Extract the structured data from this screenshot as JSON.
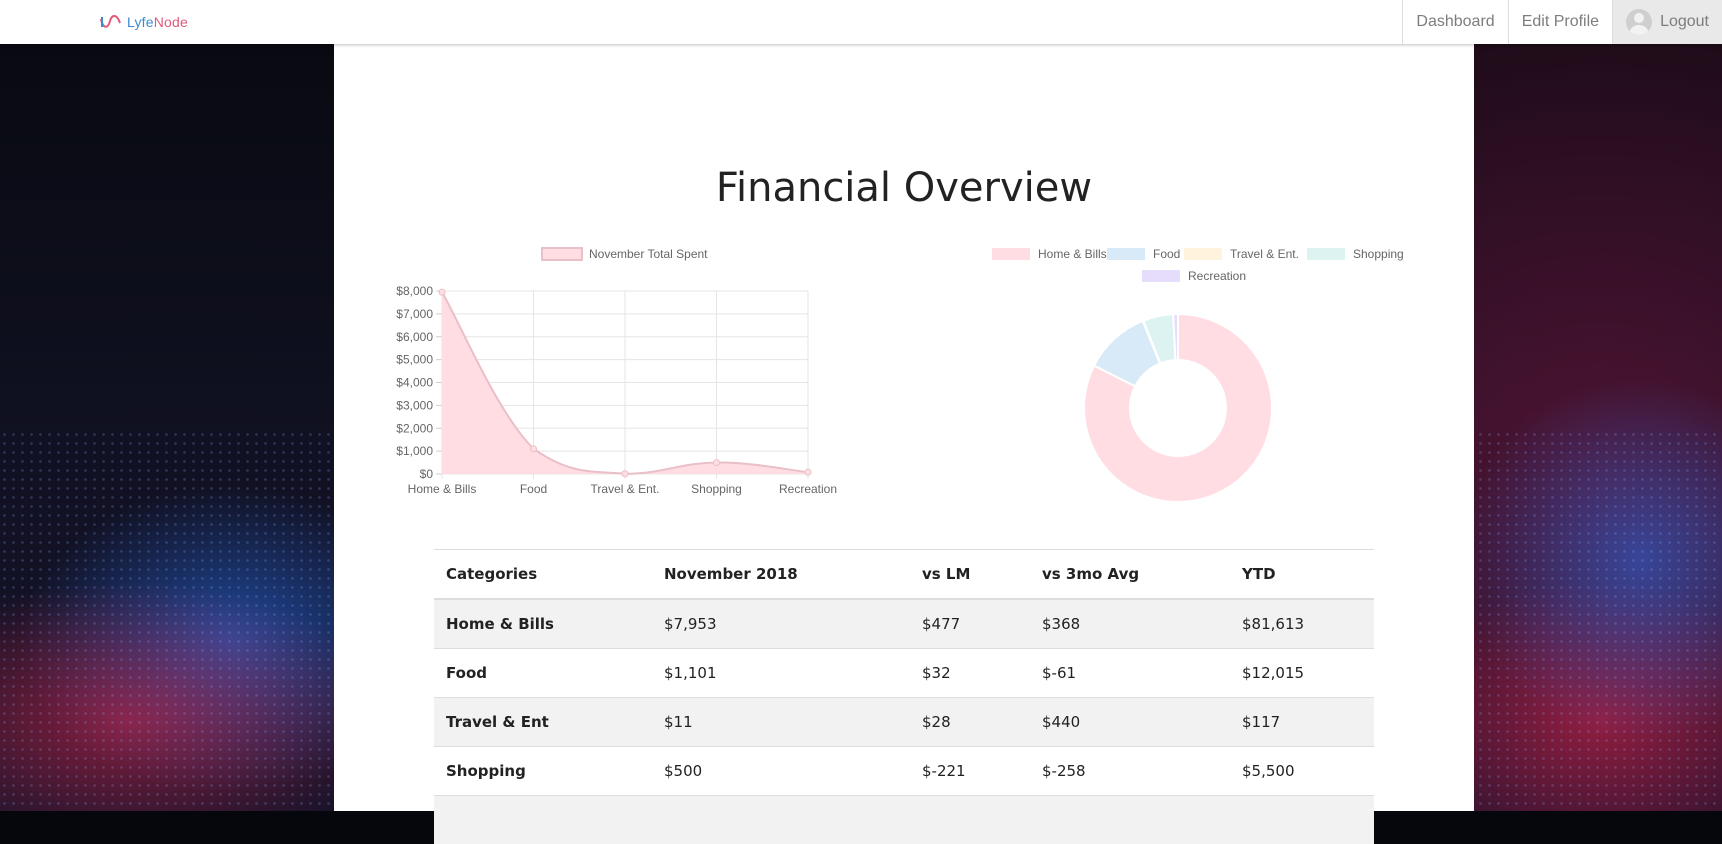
{
  "brand": {
    "part1": "Lyfe",
    "part2": "Node"
  },
  "nav": {
    "dashboard": "Dashboard",
    "edit_profile": "Edit Profile",
    "logout": "Logout"
  },
  "page": {
    "title": "Financial Overview"
  },
  "colors": {
    "pink": "#ffdde3",
    "pink_border": "#e9bfc8",
    "blue": "#d8e9f8",
    "yellow": "#fff3dd",
    "teal": "#dcf3f1",
    "purple": "#e6dcfb"
  },
  "chart_data": [
    {
      "type": "area",
      "legend": [
        "November Total Spent"
      ],
      "categories": [
        "Home & Bills",
        "Food",
        "Travel & Ent.",
        "Shopping",
        "Recreation"
      ],
      "series": [
        {
          "name": "November Total Spent",
          "values": [
            7953,
            1101,
            11,
            500,
            80
          ]
        }
      ],
      "yticks": [
        "$0",
        "$1,000",
        "$2,000",
        "$3,000",
        "$4,000",
        "$5,000",
        "$6,000",
        "$7,000",
        "$8,000"
      ],
      "ylim": [
        0,
        8000
      ],
      "grid": true,
      "legend_position": "top"
    },
    {
      "type": "doughnut",
      "categories": [
        "Home & Bills",
        "Food",
        "Travel & Ent.",
        "Shopping",
        "Recreation"
      ],
      "values": [
        7953,
        1101,
        11,
        500,
        80
      ],
      "legend_position": "top"
    }
  ],
  "table": {
    "headers": [
      "Categories",
      "November 2018",
      "vs LM",
      "vs 3mo Avg",
      "YTD"
    ],
    "rows": [
      [
        "Home & Bills",
        "$7,953",
        "$477",
        "$368",
        "$81,613"
      ],
      [
        "Food",
        "$1,101",
        "$32",
        "$-61",
        "$12,015"
      ],
      [
        "Travel & Ent",
        "$11",
        "$28",
        "$440",
        "$117"
      ],
      [
        "Shopping",
        "$500",
        "$-221",
        "$-258",
        "$5,500"
      ]
    ]
  }
}
